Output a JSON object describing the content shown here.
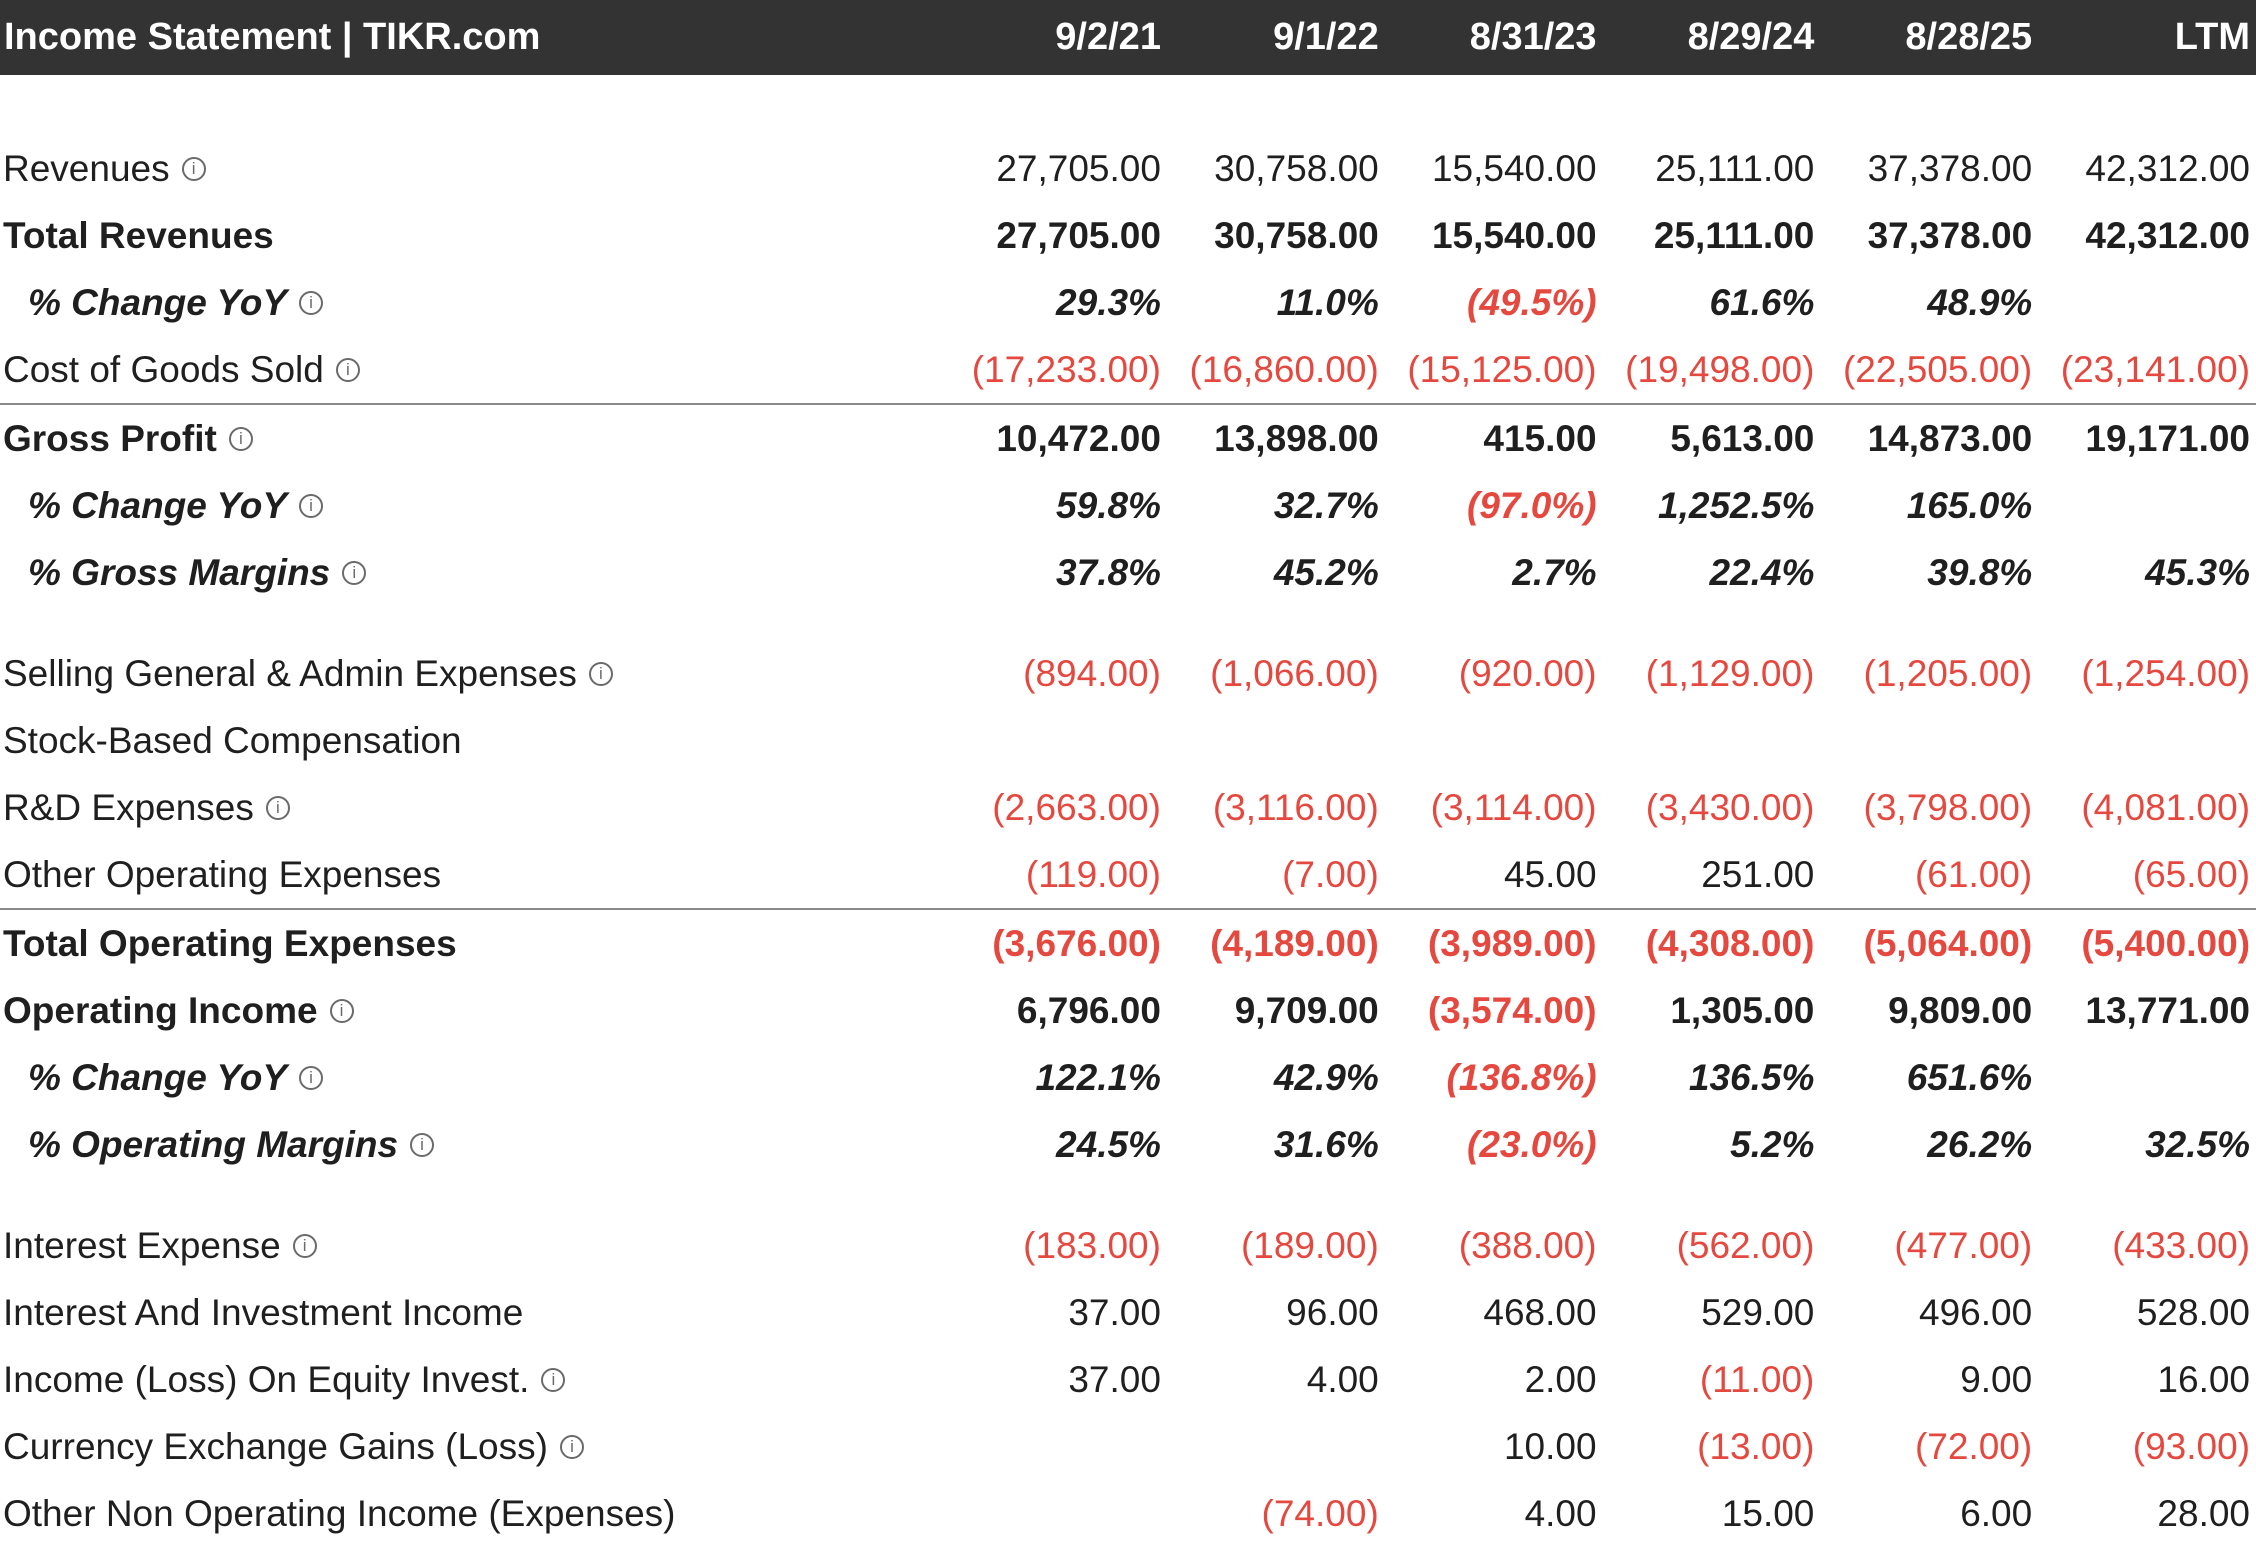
{
  "header": {
    "title": "Income Statement | TIKR.com",
    "columns": [
      "9/2/21",
      "9/1/22",
      "8/31/23",
      "8/29/24",
      "8/28/25",
      "LTM"
    ]
  },
  "icons": {
    "info": "info-circle-icon",
    "info_glyph": "i"
  },
  "colors": {
    "header_bg": "#333333",
    "negative": "#e5483f",
    "divider": "#8a8a8a"
  },
  "rows": [
    {
      "label": "Revenues",
      "info": true,
      "style": "normal",
      "values": [
        "27,705.00",
        "30,758.00",
        "15,540.00",
        "25,111.00",
        "37,378.00",
        "42,312.00"
      ]
    },
    {
      "label": "Total Revenues",
      "info": false,
      "style": "bold",
      "values": [
        "27,705.00",
        "30,758.00",
        "15,540.00",
        "25,111.00",
        "37,378.00",
        "42,312.00"
      ]
    },
    {
      "label": "% Change YoY",
      "info": true,
      "style": "italic",
      "values": [
        "29.3%",
        "11.0%",
        "(49.5%)",
        "61.6%",
        "48.9%",
        ""
      ]
    },
    {
      "label": "Cost of Goods Sold",
      "info": true,
      "style": "normal",
      "values": [
        "(17,233.00)",
        "(16,860.00)",
        "(15,125.00)",
        "(19,498.00)",
        "(22,505.00)",
        "(23,141.00)"
      ]
    },
    {
      "label": "Gross Profit",
      "info": true,
      "style": "bold",
      "divider": true,
      "values": [
        "10,472.00",
        "13,898.00",
        "415.00",
        "5,613.00",
        "14,873.00",
        "19,171.00"
      ]
    },
    {
      "label": "% Change YoY",
      "info": true,
      "style": "italic",
      "values": [
        "59.8%",
        "32.7%",
        "(97.0%)",
        "1,252.5%",
        "165.0%",
        ""
      ]
    },
    {
      "label": "% Gross Margins",
      "info": true,
      "style": "italic",
      "values": [
        "37.8%",
        "45.2%",
        "2.7%",
        "22.4%",
        "39.8%",
        "45.3%"
      ]
    },
    {
      "gap": true
    },
    {
      "label": "Selling General & Admin Expenses",
      "info": true,
      "style": "normal",
      "values": [
        "(894.00)",
        "(1,066.00)",
        "(920.00)",
        "(1,129.00)",
        "(1,205.00)",
        "(1,254.00)"
      ]
    },
    {
      "label": "Stock-Based Compensation",
      "info": false,
      "style": "normal",
      "values": [
        "",
        "",
        "",
        "",
        "",
        ""
      ]
    },
    {
      "label": "R&D Expenses",
      "info": true,
      "style": "normal",
      "values": [
        "(2,663.00)",
        "(3,116.00)",
        "(3,114.00)",
        "(3,430.00)",
        "(3,798.00)",
        "(4,081.00)"
      ]
    },
    {
      "label": "Other Operating Expenses",
      "info": false,
      "style": "normal",
      "values": [
        "(119.00)",
        "(7.00)",
        "45.00",
        "251.00",
        "(61.00)",
        "(65.00)"
      ]
    },
    {
      "label": "Total Operating Expenses",
      "info": false,
      "style": "bold",
      "divider": true,
      "values": [
        "(3,676.00)",
        "(4,189.00)",
        "(3,989.00)",
        "(4,308.00)",
        "(5,064.00)",
        "(5,400.00)"
      ]
    },
    {
      "label": "Operating Income",
      "info": true,
      "style": "bold",
      "values": [
        "6,796.00",
        "9,709.00",
        "(3,574.00)",
        "1,305.00",
        "9,809.00",
        "13,771.00"
      ]
    },
    {
      "label": "% Change YoY",
      "info": true,
      "style": "italic",
      "values": [
        "122.1%",
        "42.9%",
        "(136.8%)",
        "136.5%",
        "651.6%",
        ""
      ]
    },
    {
      "label": "% Operating Margins",
      "info": true,
      "style": "italic",
      "values": [
        "24.5%",
        "31.6%",
        "(23.0%)",
        "5.2%",
        "26.2%",
        "32.5%"
      ]
    },
    {
      "gap": true
    },
    {
      "label": "Interest Expense",
      "info": true,
      "style": "normal",
      "values": [
        "(183.00)",
        "(189.00)",
        "(388.00)",
        "(562.00)",
        "(477.00)",
        "(433.00)"
      ]
    },
    {
      "label": "Interest And Investment Income",
      "info": false,
      "style": "normal",
      "values": [
        "37.00",
        "96.00",
        "468.00",
        "529.00",
        "496.00",
        "528.00"
      ]
    },
    {
      "label": "Income (Loss) On Equity Invest.",
      "info": true,
      "style": "normal",
      "values": [
        "37.00",
        "4.00",
        "2.00",
        "(11.00)",
        "9.00",
        "16.00"
      ]
    },
    {
      "label": "Currency Exchange Gains (Loss)",
      "info": true,
      "style": "normal",
      "values": [
        "",
        "",
        "10.00",
        "(13.00)",
        "(72.00)",
        "(93.00)"
      ]
    },
    {
      "label": "Other Non Operating Income (Expenses)",
      "info": false,
      "style": "normal",
      "values": [
        "",
        "(74.00)",
        "4.00",
        "15.00",
        "6.00",
        "28.00"
      ]
    }
  ]
}
